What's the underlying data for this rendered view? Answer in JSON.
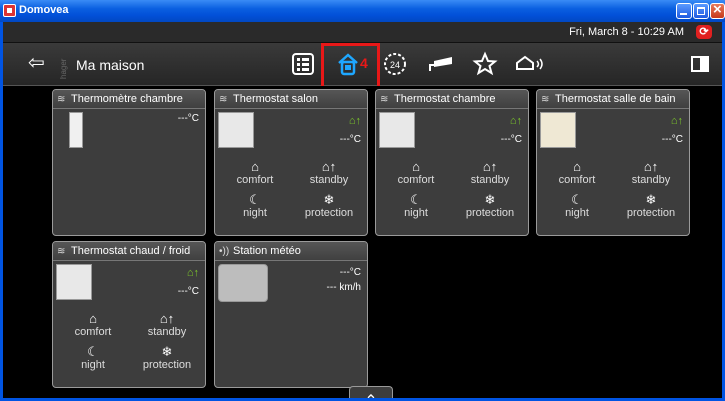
{
  "window": {
    "title": "Domovea"
  },
  "status": {
    "datetime": "Fri, March 8 - 10:29 AM"
  },
  "toolbar": {
    "back_icon": "back-arrow-icon",
    "logo": "hager",
    "house_title": "Ma maison",
    "annotation_number": "4",
    "icons": [
      "list-view-icon",
      "house-icon",
      "24h-timer-icon",
      "camera-icon",
      "star-icon",
      "house-signal-icon",
      "exit-icon"
    ],
    "accent": "#1ea7ff"
  },
  "cards": [
    {
      "title": "Thermomètre chambre",
      "values": [
        "---°C"
      ]
    },
    {
      "title": "Thermostat salon",
      "values": [
        "---°C"
      ],
      "modes": [
        "comfort",
        "standby",
        "night",
        "protection"
      ]
    },
    {
      "title": "Thermostat chambre",
      "values": [
        "---°C"
      ],
      "modes": [
        "comfort",
        "standby",
        "night",
        "protection"
      ]
    },
    {
      "title": "Thermostat salle de bain",
      "values": [
        "---°C"
      ],
      "modes": [
        "comfort",
        "standby",
        "night",
        "protection"
      ]
    },
    {
      "title": "Thermostat chaud / froid",
      "values": [
        "---°C"
      ],
      "modes": [
        "comfort",
        "standby",
        "night",
        "protection"
      ]
    },
    {
      "title": "Station météo",
      "values": [
        "---°C",
        "--- km/h"
      ]
    }
  ],
  "colors": {
    "highlight": "#e81818",
    "mode_active": "#7cc72a"
  }
}
